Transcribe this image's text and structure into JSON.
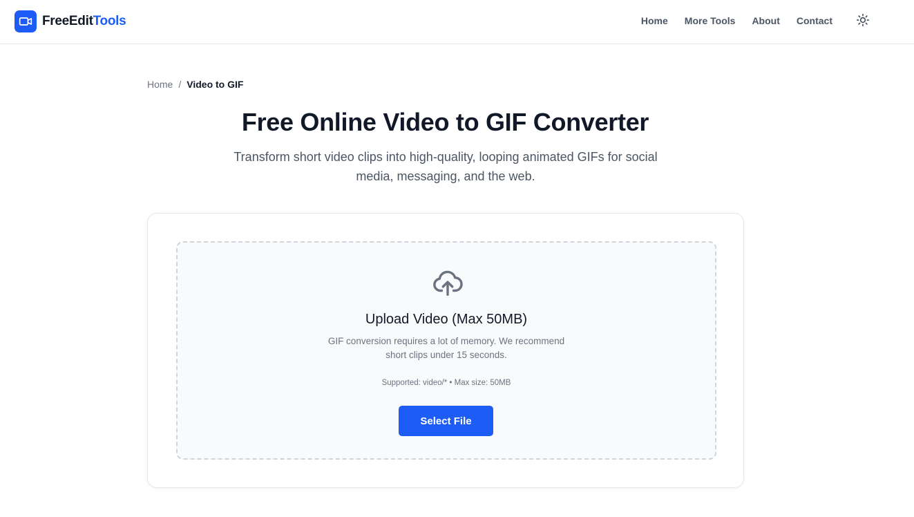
{
  "header": {
    "brand": {
      "part1": "FreeEdit",
      "part2": "Tools",
      "logo_icon": "video-camera-icon"
    },
    "nav": [
      {
        "label": "Home"
      },
      {
        "label": "More Tools"
      },
      {
        "label": "About"
      },
      {
        "label": "Contact"
      }
    ],
    "theme_toggle_icon": "sun-icon"
  },
  "breadcrumb": {
    "home": "Home",
    "separator": "/",
    "current": "Video to GIF"
  },
  "page": {
    "title": "Free Online Video to GIF Converter",
    "subtitle": "Transform short video clips into high-quality, looping animated GIFs for social media, messaging, and the web."
  },
  "upload": {
    "icon": "cloud-upload-icon",
    "title": "Upload Video (Max 50MB)",
    "description": "GIF conversion requires a lot of memory. We recommend short clips under 15 seconds.",
    "supported": "Supported: video/* • Max size: 50MB",
    "button_label": "Select File"
  },
  "colors": {
    "accent": "#1d5cf5",
    "text_primary": "#111827",
    "text_muted": "#6b7280"
  }
}
